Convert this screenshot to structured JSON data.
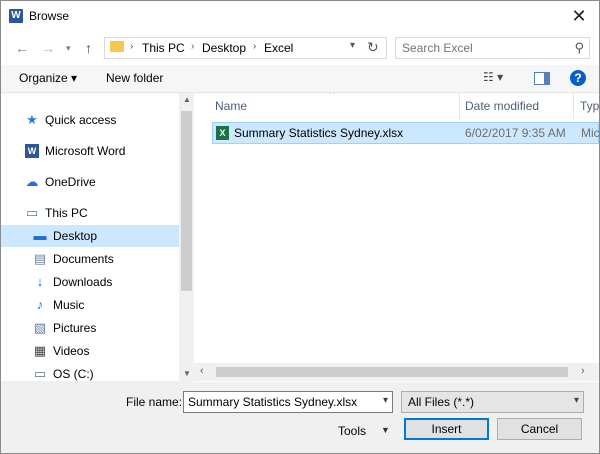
{
  "window": {
    "title": "Browse",
    "app_icon": "W"
  },
  "address": {
    "crumbs": [
      "This PC",
      "Desktop",
      "Excel"
    ]
  },
  "search": {
    "placeholder": "Search Excel"
  },
  "toolbar": {
    "organize": "Organize ▾",
    "new_folder": "New folder",
    "help": "?"
  },
  "nav": {
    "items": [
      {
        "label": "Quick access",
        "icon": "star-icon"
      },
      {
        "label": "Microsoft Word",
        "icon": "word-icon"
      },
      {
        "label": "OneDrive",
        "icon": "cloud-icon"
      },
      {
        "label": "This PC",
        "icon": "computer-icon"
      },
      {
        "label": "Desktop",
        "icon": "desktop-icon"
      },
      {
        "label": "Documents",
        "icon": "documents-icon"
      },
      {
        "label": "Downloads",
        "icon": "download-icon"
      },
      {
        "label": "Music",
        "icon": "music-icon"
      },
      {
        "label": "Pictures",
        "icon": "pictures-icon"
      },
      {
        "label": "Videos",
        "icon": "videos-icon"
      },
      {
        "label": "OS (C:)",
        "icon": "drive-icon"
      }
    ]
  },
  "files": {
    "columns": {
      "name": "Name",
      "date": "Date modified",
      "type": "Typ"
    },
    "rows": [
      {
        "name": "Summary Statistics Sydney.xlsx",
        "date": "6/02/2017 9:35 AM",
        "type": "Mic"
      }
    ]
  },
  "footer": {
    "filename_label": "File name:",
    "filename_value": "Summary Statistics Sydney.xlsx",
    "filetype": "All Files (*.*)",
    "tools": "Tools",
    "insert": "Insert",
    "cancel": "Cancel"
  },
  "colors": {
    "selection": "#cce8ff",
    "accent": "#0078d7"
  }
}
